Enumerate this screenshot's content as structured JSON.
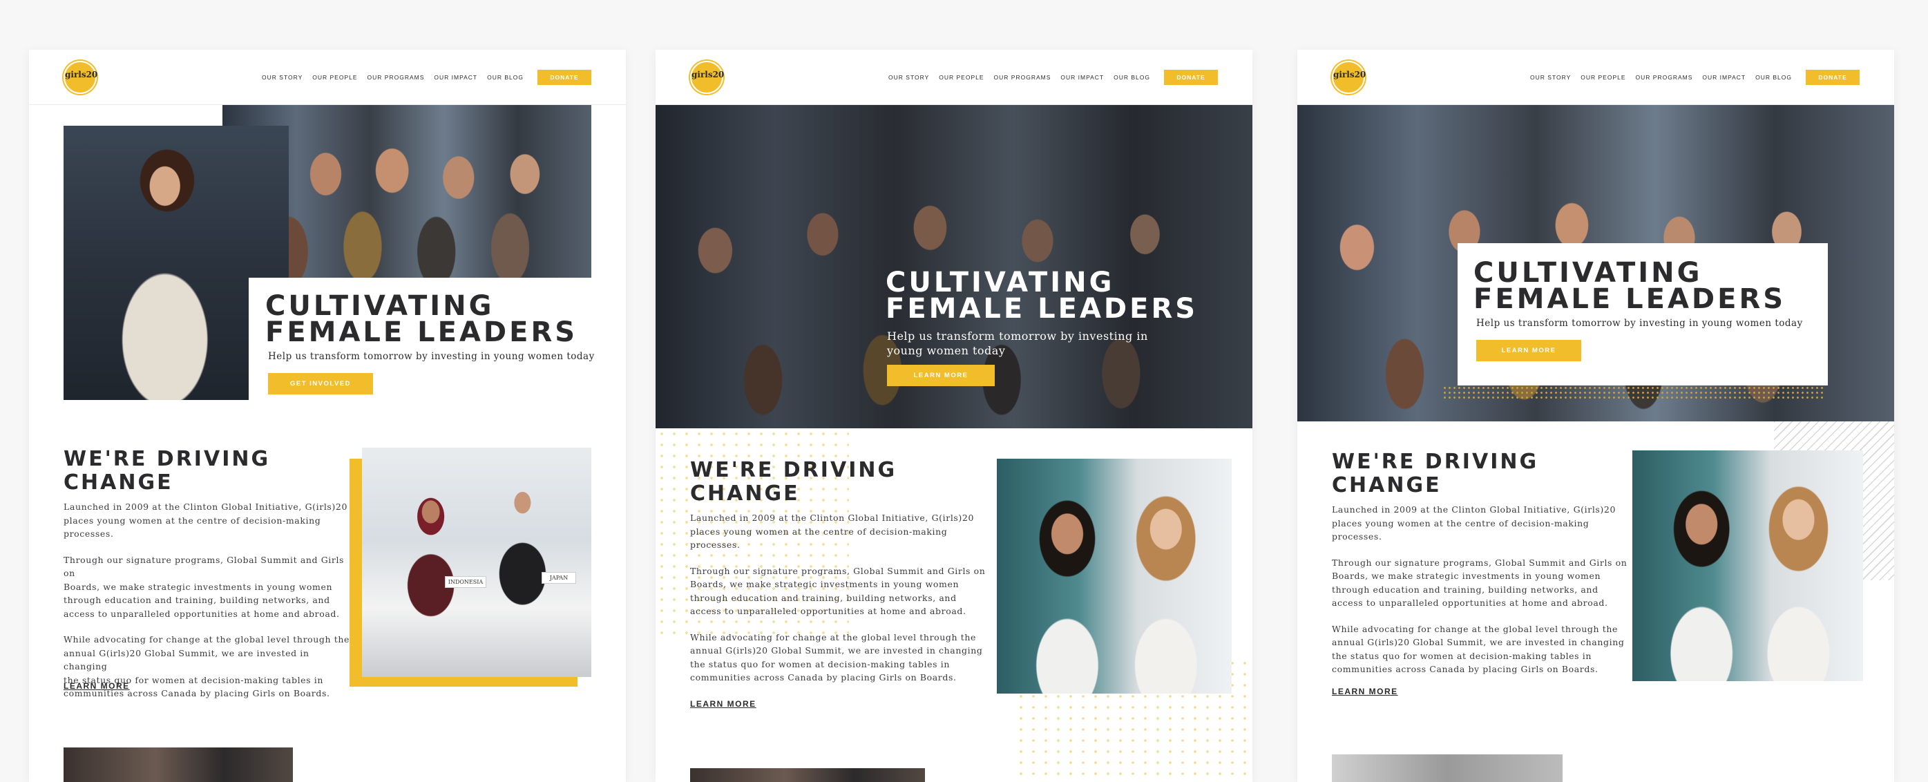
{
  "brand": {
    "logo_text": "girls20",
    "accent": "#f2bd2a",
    "dark": "#2b2a2c"
  },
  "nav": {
    "items": [
      "OUR STORY",
      "OUR PEOPLE",
      "OUR PROGRAMS",
      "OUR IMPACT",
      "OUR BLOG"
    ],
    "donate": "DONATE"
  },
  "hero": {
    "title_line1": "CULTIVATING",
    "title_line2": "FEMALE LEADERS",
    "subtitle": "Help us transform tomorrow by investing in young women today",
    "subtitle_wrap_1": "Help us transform tomorrow by investing in",
    "subtitle_wrap_2": "young women today",
    "cta_get_involved": "GET INVOLVED",
    "cta_learn_more": "LEARN MORE"
  },
  "about": {
    "title_line1": "WE'RE DRIVING",
    "title_line2": "CHANGE",
    "p1_line1": "Launched in 2009 at the Clinton Global Initiative, G(irls)20",
    "p1_line2": "places young women at the centre of decision-making",
    "p1_line3": "processes.",
    "p2_line1": "Through our signature programs, Global Summit and Girls on",
    "p2_line2": "Boards, we make strategic investments in young women",
    "p2_line3": "through education and training, building networks, and",
    "p2_line4": "access to unparalleled opportunities at home and abroad.",
    "p3_line1": "While advocating for change at the global level through the",
    "p3_line2": "annual G(irls)20 Global Summit, we are invested in changing",
    "p3_line3": "the status quo for women at decision-making tables in",
    "p3_line4": "communities across Canada by placing Girls on Boards.",
    "learn_more": "LEARN MORE",
    "name_tag_1": "INDONESIA",
    "name_tag_2": "JAPAN"
  }
}
